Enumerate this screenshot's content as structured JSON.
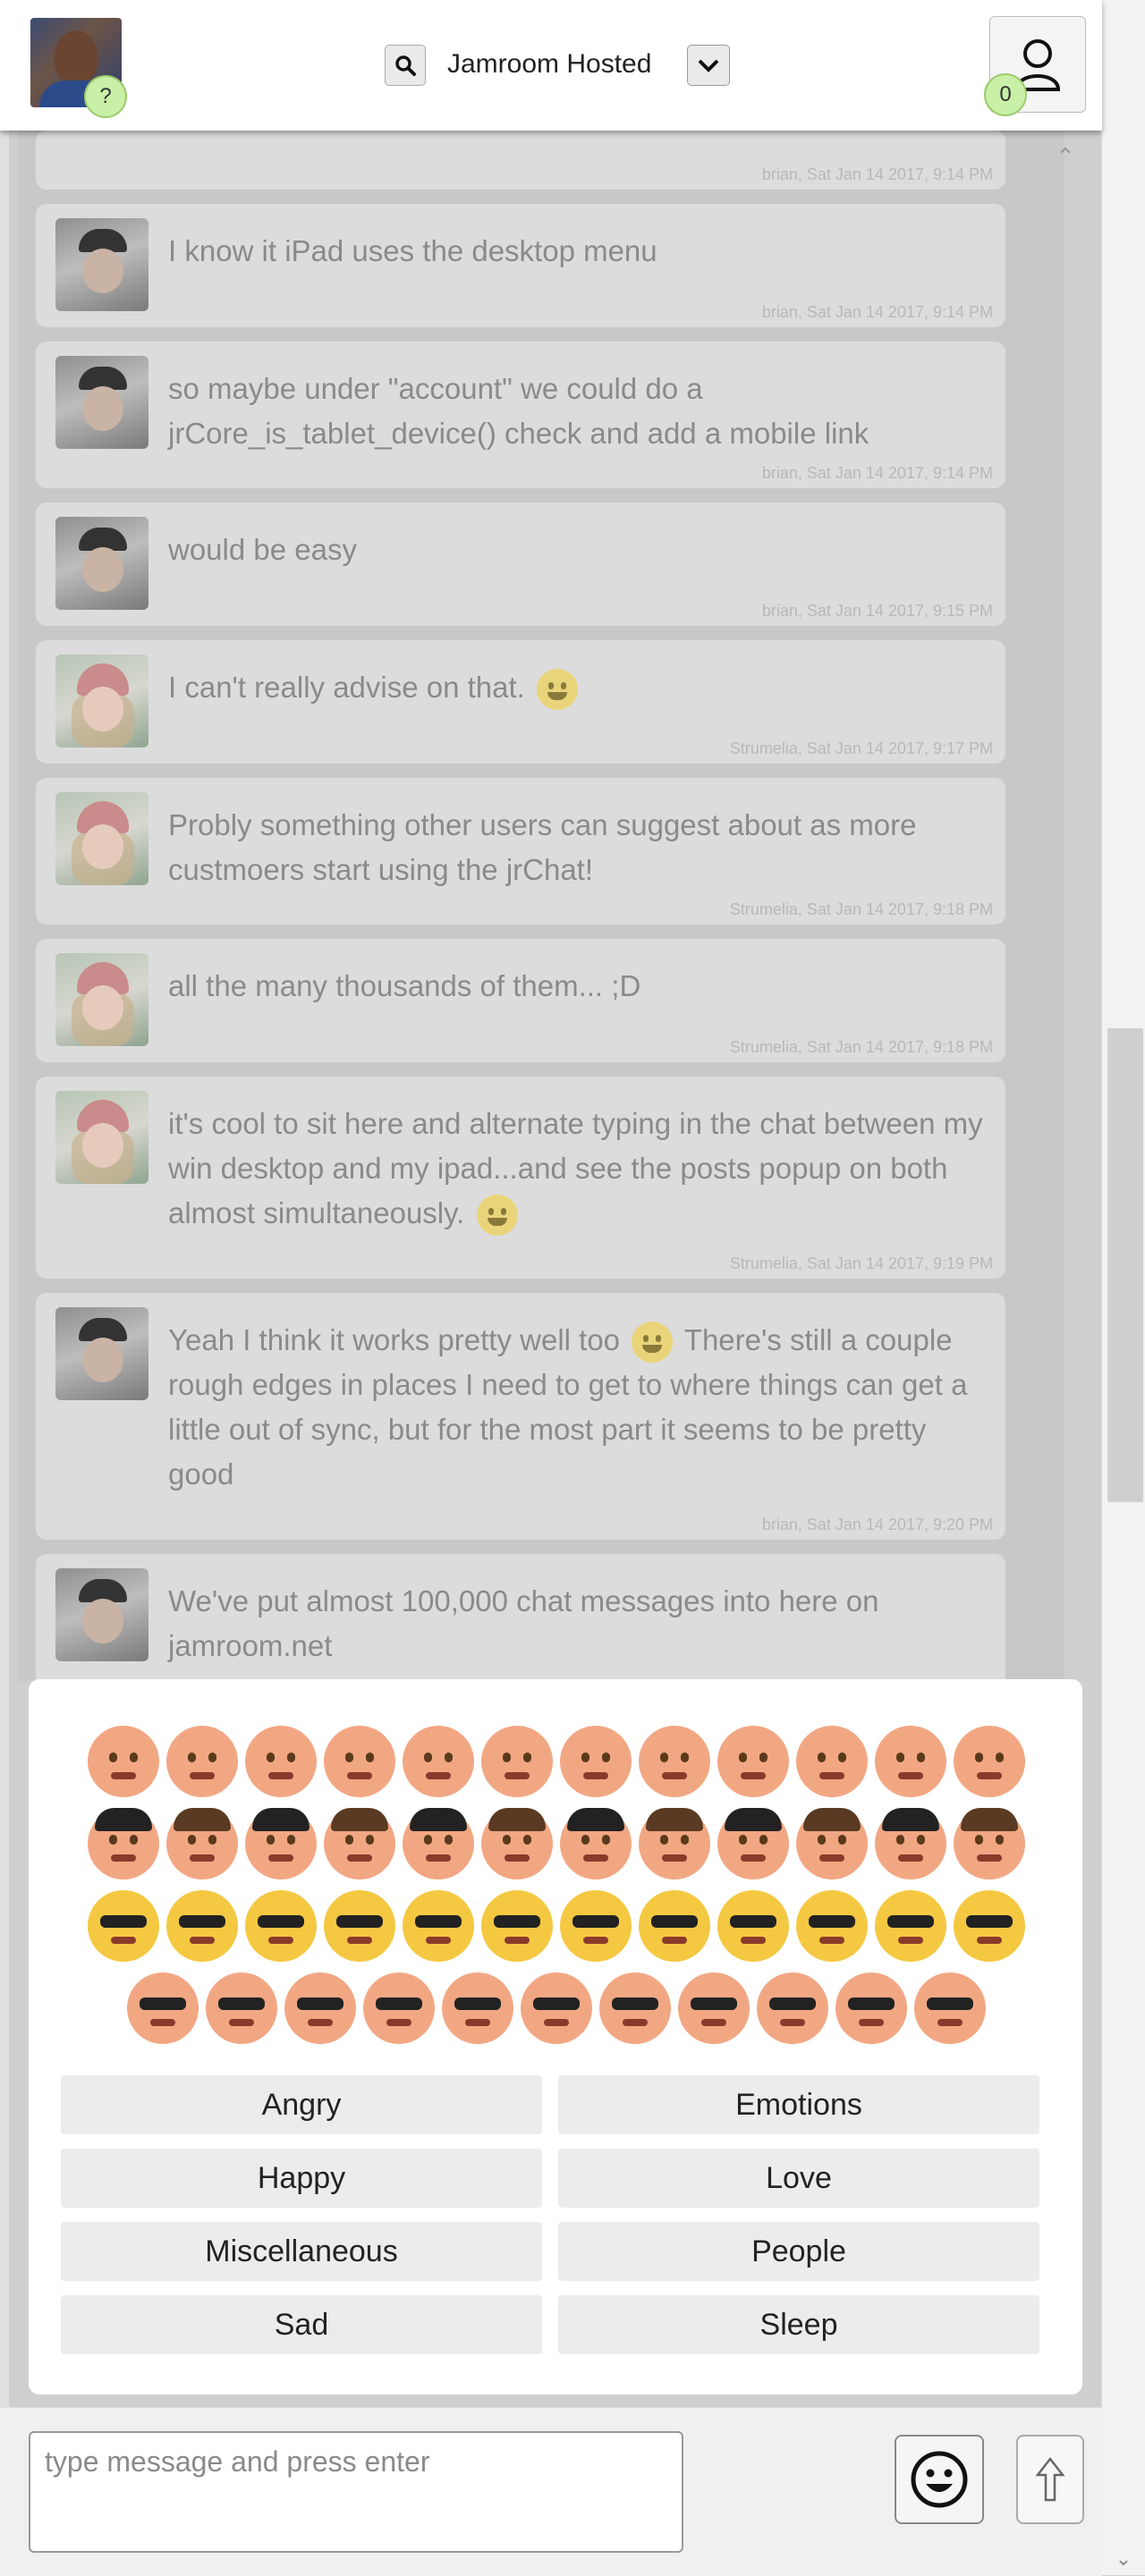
{
  "header": {
    "help_badge": "?",
    "room_title": "Jamroom Hosted",
    "user_count": "0"
  },
  "messages": [
    {
      "author_class": "brian",
      "text": "I know it iPad uses the desktop menu",
      "meta": "brian, Sat Jan 14 2017, 9:14 PM"
    },
    {
      "author_class": "brian",
      "text": "so maybe under \"account\" we could do a jrCore_is_tablet_device() check and add a mobile link",
      "meta": "brian, Sat Jan 14 2017, 9:14 PM"
    },
    {
      "author_class": "brian",
      "text": "would be easy",
      "meta": "brian, Sat Jan 14 2017, 9:15 PM"
    },
    {
      "author_class": "strum",
      "text": "I can't really advise on that.",
      "meta": "Strumelia, Sat Jan 14 2017, 9:17 PM"
    },
    {
      "author_class": "strum",
      "text": "Probly something other users can suggest about as more custmoers start using the jrChat!",
      "meta": "Strumelia, Sat Jan 14 2017, 9:18 PM"
    },
    {
      "author_class": "strum",
      "text": "all the many thousands of them... ;D",
      "meta": "Strumelia, Sat Jan 14 2017, 9:18 PM"
    },
    {
      "author_class": "strum",
      "text": "it's cool to sit here and alternate typing in the chat between my win desktop and my ipad...and see the posts popup on both almost simultaneously.",
      "meta": "Strumelia, Sat Jan 14 2017, 9:19 PM"
    },
    {
      "author_class": "brian",
      "text_before": "Yeah I think it works pretty well too",
      "text_after": "There's still a couple rough edges in places I need to get to where things can get a little out of sync, but for the most part it seems to be pretty good",
      "meta": "brian, Sat Jan 14 2017, 9:20 PM"
    },
    {
      "author_class": "brian",
      "text": "We've put almost 100,000 chat messages into here on jamroom.net",
      "meta": ""
    }
  ],
  "emoji_categories": [
    "Angry",
    "Emotions",
    "Happy",
    "Love",
    "Miscellaneous",
    "People",
    "Sad",
    "Sleep"
  ],
  "colors": {
    "accent_badge": "#c8f0a6",
    "bubble": "#dcdcdc",
    "emoji_yellow": "#f5c842",
    "emoji_skin": "#f2a783"
  },
  "footer": {
    "placeholder": "type message and press enter"
  }
}
